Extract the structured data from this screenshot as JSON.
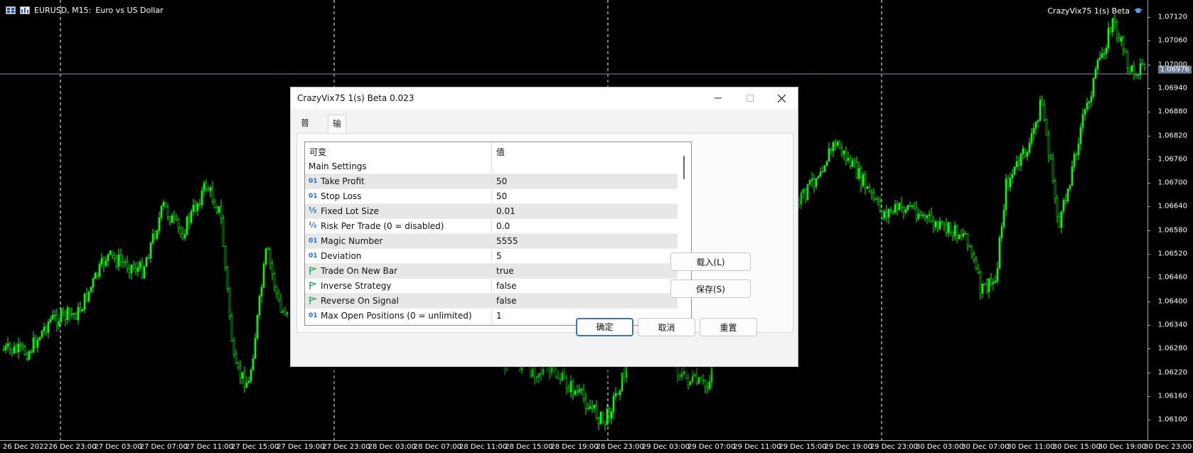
{
  "chart": {
    "symbol": "EURUSD, M15:",
    "description": "Euro vs US Dollar",
    "ea_name": "CrazyVix75 1(s) Beta",
    "current_price": "1.06976",
    "price_ticks": [
      "1.07120",
      "1.07060",
      "1.07000",
      "1.06940",
      "1.06880",
      "1.06820",
      "1.06760",
      "1.06700",
      "1.06640",
      "1.06580",
      "1.06520",
      "1.06460",
      "1.06400",
      "1.06340",
      "1.06280",
      "1.06220",
      "1.06160",
      "1.06100"
    ],
    "time_ticks": [
      "26 Dec 2022",
      "26 Dec 23:00",
      "27 Dec 03:00",
      "27 Dec 07:00",
      "27 Dec 11:00",
      "27 Dec 15:00",
      "27 Dec 19:00",
      "27 Dec 23:00",
      "28 Dec 03:00",
      "28 Dec 07:00",
      "28 Dec 11:00",
      "28 Dec 15:00",
      "28 Dec 19:00",
      "28 Dec 23:00",
      "29 Dec 03:00",
      "29 Dec 07:00",
      "29 Dec 11:00",
      "29 Dec 15:00",
      "29 Dec 19:00",
      "29 Dec 23:00",
      "30 Dec 03:00",
      "30 Dec 07:00",
      "30 Dec 11:00",
      "30 Dec 15:00",
      "30 Dec 19:00",
      "30 Dec 23:00"
    ],
    "colors": {
      "background": "#000000",
      "candles": "#00ff00",
      "grid": "#ffffff",
      "bid_line": "#7f95b3"
    }
  },
  "dialog": {
    "title": "CrazyVix75 1(s) Beta 0.023",
    "tabs": [
      {
        "label": "普通",
        "active": false
      },
      {
        "label": "输入",
        "active": true
      }
    ],
    "grid": {
      "headers": {
        "variable": "可变",
        "value": "值"
      },
      "rows": [
        {
          "name": "Main Settings",
          "value": "",
          "type": "section"
        },
        {
          "name": "Take Profit",
          "value": "50",
          "type": "int"
        },
        {
          "name": "Stop Loss",
          "value": "50",
          "type": "int"
        },
        {
          "name": "Fixed Lot Size",
          "value": "0.01",
          "type": "double"
        },
        {
          "name": "Risk Per Trade (0 = disabled)",
          "value": "0.0",
          "type": "double"
        },
        {
          "name": "Magic Number",
          "value": "5555",
          "type": "int"
        },
        {
          "name": "Deviation",
          "value": "5",
          "type": "int"
        },
        {
          "name": "Trade On New Bar",
          "value": "true",
          "type": "bool"
        },
        {
          "name": "Inverse Strategy",
          "value": "false",
          "type": "bool"
        },
        {
          "name": "Reverse On Signal",
          "value": "false",
          "type": "bool"
        },
        {
          "name": "Max Open Positions (0 = unlimited)",
          "value": "1",
          "type": "int"
        }
      ],
      "icons": {
        "int": "01",
        "double": "½"
      }
    },
    "buttons": {
      "load": "载入(L)",
      "save": "保存(S)",
      "ok": "确定",
      "cancel": "取消",
      "reset": "重置"
    }
  }
}
